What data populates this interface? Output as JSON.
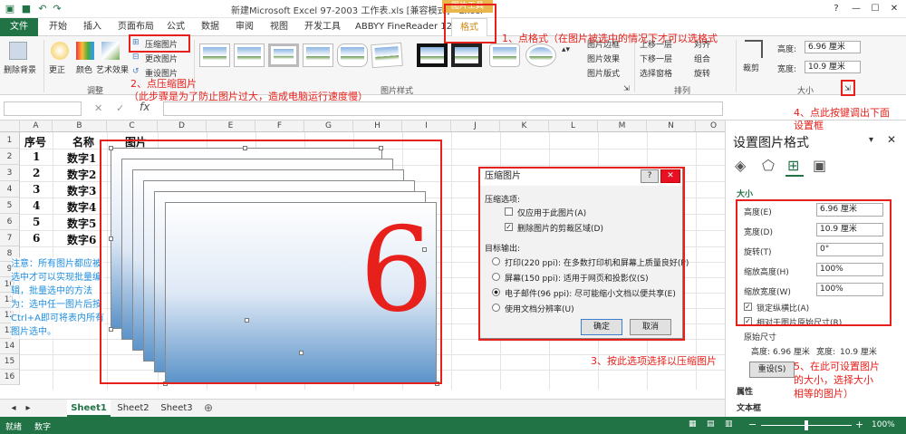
{
  "titlebar": {
    "title": "新建Microsoft Excel 97-2003 工作表.xls  [兼容模式] - Excel",
    "context_tab": "图片工具",
    "win_help": "?",
    "win_min": "—",
    "win_max": "☐",
    "win_close": "✕"
  },
  "tabs": {
    "file": "文件",
    "items": [
      "开始",
      "插入",
      "页面布局",
      "公式",
      "数据",
      "审阅",
      "视图",
      "开发工具",
      "ABBYY FineReader 12"
    ],
    "active": "格式"
  },
  "ribbon": {
    "adjust": {
      "remove_bg": "删除背景",
      "correct": "更正",
      "color": "颜色",
      "artistic": "艺术效果",
      "compress": "压缩图片",
      "change": "更改图片",
      "reset": "重设图片",
      "label": "调整"
    },
    "styles": {
      "label": "图片样式",
      "border": "图片边框",
      "effects": "图片效果",
      "layout": "图片版式"
    },
    "arrange": {
      "label": "排列",
      "forward": "上移一层",
      "backward": "下移一层",
      "pane": "选择窗格",
      "align": "对齐",
      "group": "组合",
      "rotate": "旋转"
    },
    "size": {
      "label": "大小",
      "crop": "裁剪",
      "height_label": "高度:",
      "height": "6.96 厘米",
      "width_label": "宽度:",
      "width": "10.9 厘米"
    }
  },
  "formula": {
    "fx": "fx",
    "cancel": "✕",
    "confirm": "✓"
  },
  "grid": {
    "columns": [
      "A",
      "B",
      "C",
      "D",
      "E",
      "F",
      "G",
      "H",
      "I",
      "J",
      "K",
      "L",
      "M",
      "N",
      "O"
    ],
    "rows": [
      "1",
      "2",
      "3",
      "4",
      "5",
      "6",
      "7",
      "8",
      "9",
      "10",
      "11",
      "12",
      "13",
      "14",
      "15",
      "16"
    ],
    "header": [
      "序号",
      "名称",
      "图片"
    ],
    "data": [
      [
        "1",
        "数字1"
      ],
      [
        "2",
        "数字2"
      ],
      [
        "3",
        "数字3"
      ],
      [
        "4",
        "数字4"
      ],
      [
        "5",
        "数字5"
      ],
      [
        "6",
        "数字6"
      ]
    ],
    "big_digit": "6"
  },
  "dialog": {
    "title": "压缩图片",
    "help": "?",
    "close": "✕",
    "options_label": "压缩选项:",
    "opt_only_this": "仅应用于此图片(A)",
    "opt_only_this_checked": false,
    "opt_delete_crop": "删除图片的剪裁区域(D)",
    "opt_delete_crop_checked": true,
    "target_label": "目标输出:",
    "targets": [
      "打印(220 ppi): 在多数打印机和屏幕上质量良好(P)",
      "屏幕(150 ppi): 适用于网页和投影仪(S)",
      "电子邮件(96 ppi): 尽可能缩小文档以便共享(E)",
      "使用文档分辨率(U)"
    ],
    "selected_target": 2,
    "ok": "确定",
    "cancel": "取消"
  },
  "pane": {
    "title": "设置图片格式",
    "close": "✕",
    "pin": "▾",
    "section_size": "大小",
    "height_label": "高度(E)",
    "height": "6.96 厘米",
    "width_label": "宽度(D)",
    "width": "10.9 厘米",
    "rotation_label": "旋转(T)",
    "rotation": "0°",
    "scale_h_label": "缩放高度(H)",
    "scale_h": "100%",
    "scale_w_label": "缩放宽度(W)",
    "scale_w": "100%",
    "lock_aspect": "锁定纵横比(A)",
    "relative_original": "相对于图片原始尺寸(R)",
    "original_label": "原始尺寸",
    "orig_h_label": "高度:",
    "orig_h": "6.96 厘米",
    "orig_w_label": "宽度:",
    "orig_w": "10.9 厘米",
    "reset": "重设(S)",
    "section_props": "属性",
    "section_text": "文本框"
  },
  "sheets": {
    "tabs": [
      "Sheet1",
      "Sheet2",
      "Sheet3"
    ],
    "active": 0,
    "add": "⊕"
  },
  "status": {
    "ready": "就绪",
    "mode": "数字",
    "zoom": "100%",
    "zoom_minus": "−",
    "zoom_plus": "+"
  },
  "annotations": {
    "a1": "1、点格式（在图片被选中的情况下才可以选格式",
    "a2": "2、点压缩图片",
    "a2b": "（此步骤是为了防止图片过大，造成电脑运行速度慢）",
    "a3": "3、按此选项选择以压缩图片",
    "a4": "4、点此按键调出下面",
    "a4b": "设置框",
    "a5": "5、在此可设置图片",
    "a5b": "的大小，选择大小",
    "a5c": "相等的图片）",
    "note": "注意：所有图片都应被选中才可以实现批量编辑，批量选中的方法为：选中任一图片后按Ctrl+A即可将表内所有图片选中。"
  },
  "colors": {
    "excel_green": "#217346",
    "annot_red": "#e8201b",
    "note_blue": "#1e8ee0",
    "tools_orange": "#e8b64a"
  }
}
